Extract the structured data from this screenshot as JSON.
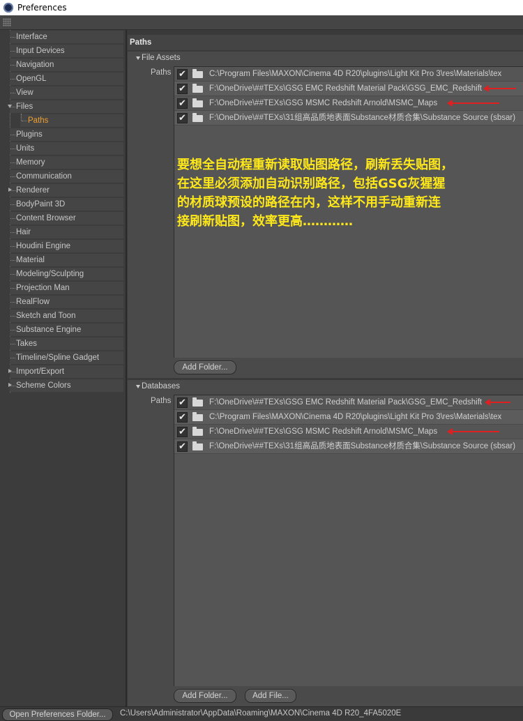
{
  "window": {
    "title": "Preferences"
  },
  "sidebar": {
    "items": [
      {
        "label": "Interface"
      },
      {
        "label": "Input Devices"
      },
      {
        "label": "Navigation"
      },
      {
        "label": "OpenGL"
      },
      {
        "label": "View"
      },
      {
        "label": "Files",
        "expanded": true
      },
      {
        "label": "Paths",
        "child": true,
        "selected": true
      },
      {
        "label": "Plugins"
      },
      {
        "label": "Units"
      },
      {
        "label": "Memory"
      },
      {
        "label": "Communication"
      },
      {
        "label": "Renderer",
        "collapsed": true
      },
      {
        "label": "BodyPaint 3D"
      },
      {
        "label": "Content Browser"
      },
      {
        "label": "Hair"
      },
      {
        "label": "Houdini Engine"
      },
      {
        "label": "Material"
      },
      {
        "label": "Modeling/Sculpting"
      },
      {
        "label": "Projection Man"
      },
      {
        "label": "RealFlow"
      },
      {
        "label": "Sketch and Toon"
      },
      {
        "label": "Substance Engine"
      },
      {
        "label": "Takes"
      },
      {
        "label": "Timeline/Spline Gadget"
      },
      {
        "label": "Import/Export",
        "collapsed": true
      },
      {
        "label": "Scheme Colors",
        "collapsed": true
      }
    ]
  },
  "main": {
    "title": "Paths",
    "file_assets": {
      "header": "File Assets",
      "label": "Paths",
      "rows": [
        {
          "path": "C:\\Program Files\\MAXON\\Cinema 4D R20\\plugins\\Light Kit Pro 3\\res\\Materials\\tex",
          "checked": true
        },
        {
          "path": "F:\\OneDrive\\##TEXs\\GSG EMC Redshift Material Pack\\GSG_EMC_Redshift",
          "checked": true
        },
        {
          "path": "F:\\OneDrive\\##TEXs\\GSG MSMC Redshift Arnold\\MSMC_Maps",
          "checked": true
        },
        {
          "path": "F:\\OneDrive\\##TEXs\\31组高品质地表面Substance材质合集\\Substance Source (sbsar)",
          "checked": true
        }
      ],
      "add_folder": "Add Folder..."
    },
    "databases": {
      "header": "Databases",
      "label": "Paths",
      "rows": [
        {
          "path": "F:\\OneDrive\\##TEXs\\GSG EMC Redshift Material Pack\\GSG_EMC_Redshift",
          "checked": true
        },
        {
          "path": "C:\\Program Files\\MAXON\\Cinema 4D R20\\plugins\\Light Kit Pro 3\\res\\Materials\\tex",
          "checked": true
        },
        {
          "path": "F:\\OneDrive\\##TEXs\\GSG MSMC Redshift Arnold\\MSMC_Maps",
          "checked": true
        },
        {
          "path": "F:\\OneDrive\\##TEXs\\31组高品质地表面Substance材质合集\\Substance Source (sbsar)",
          "checked": true
        }
      ],
      "add_folder": "Add Folder...",
      "add_file": "Add File..."
    },
    "annotation": {
      "lines": [
        "要想全自动程重新读取贴图路径，刷新丢失贴图，",
        "在这里必须添加自动识别路径，包括GSG灰猩猩",
        "的材质球预设的路径在内，这样不用手动重新连",
        "接刷新贴图，效率更高…………"
      ],
      "color": "#ffe81a"
    },
    "arrow_color": "#e02020"
  },
  "statusbar": {
    "open_button": "Open Preferences Folder...",
    "path": "C:\\Users\\Administrator\\AppData\\Roaming\\MAXON\\Cinema 4D R20_4FA5020E"
  }
}
